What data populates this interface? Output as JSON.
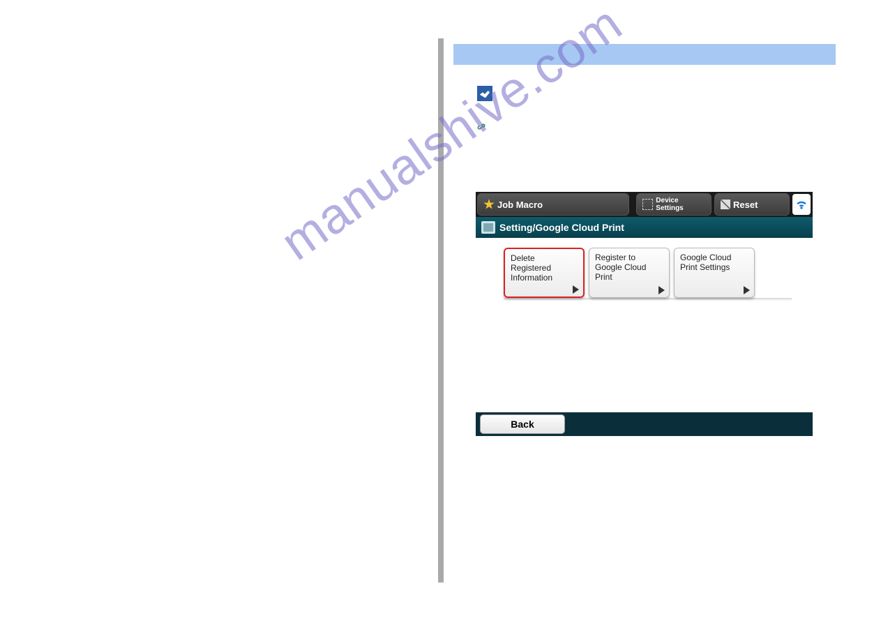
{
  "watermark": "manualshive.com",
  "memo_label": "",
  "link_label": "",
  "screenshot": {
    "topbar": {
      "job_macro": "Job Macro",
      "device_settings": "Device Settings",
      "reset": "Reset"
    },
    "breadcrumb": "Setting/Google Cloud Print",
    "options": [
      {
        "label": "Delete Registered Information",
        "selected": true
      },
      {
        "label": "Register to Google Cloud Print",
        "selected": false
      },
      {
        "label": "Google Cloud Print Settings",
        "selected": false
      }
    ],
    "back": "Back"
  }
}
